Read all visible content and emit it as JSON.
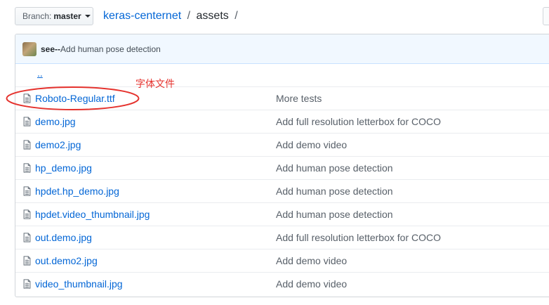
{
  "branch": {
    "label": "Branch:",
    "value": "master"
  },
  "breadcrumb": {
    "repo": "keras-centernet",
    "separator": "/",
    "current": "assets"
  },
  "commit": {
    "author": "see--",
    "message": "Add human pose detection"
  },
  "up_link": "..",
  "files": [
    {
      "name": "Roboto-Regular.ttf",
      "message": "More tests"
    },
    {
      "name": "demo.jpg",
      "message": "Add full resolution letterbox for COCO"
    },
    {
      "name": "demo2.jpg",
      "message": "Add demo video"
    },
    {
      "name": "hp_demo.jpg",
      "message": "Add human pose detection"
    },
    {
      "name": "hpdet.hp_demo.jpg",
      "message": "Add human pose detection"
    },
    {
      "name": "hpdet.video_thumbnail.jpg",
      "message": "Add human pose detection"
    },
    {
      "name": "out.demo.jpg",
      "message": "Add full resolution letterbox for COCO"
    },
    {
      "name": "out.demo2.jpg",
      "message": "Add demo video"
    },
    {
      "name": "video_thumbnail.jpg",
      "message": "Add demo video"
    }
  ],
  "annotation": {
    "text": "字体文件",
    "color": "#e5322d"
  },
  "colors": {
    "link": "#0366d6",
    "commit_bar": "#f1f8ff"
  },
  "icons": {
    "file": "file-icon",
    "caret": "caret-down-icon"
  }
}
